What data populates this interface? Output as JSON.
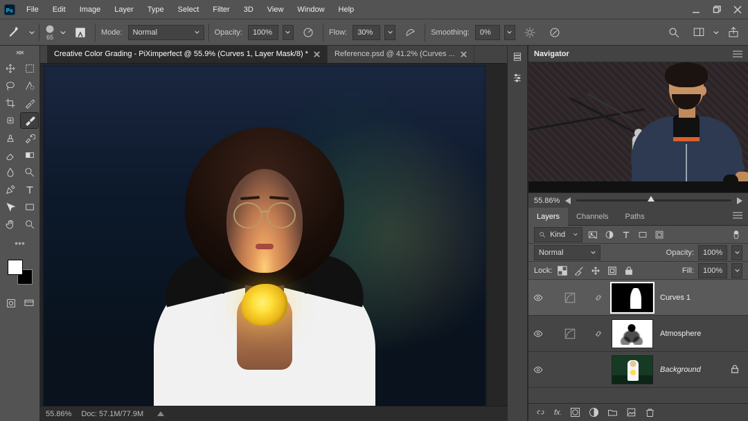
{
  "menu": {
    "items": [
      "File",
      "Edit",
      "Image",
      "Layer",
      "Type",
      "Select",
      "Filter",
      "3D",
      "View",
      "Window",
      "Help"
    ]
  },
  "options": {
    "brush_size": "65",
    "mode_label": "Mode:",
    "mode_value": "Normal",
    "opacity_label": "Opacity:",
    "opacity_value": "100%",
    "flow_label": "Flow:",
    "flow_value": "30%",
    "smoothing_label": "Smoothing:",
    "smoothing_value": "0%"
  },
  "tabs": {
    "active": "Creative Color Grading - PiXimperfect @ 55.9% (Curves 1, Layer Mask/8) *",
    "inactive": "Reference.psd @ 41.2% (Curves ..."
  },
  "status": {
    "zoom": "55.86%",
    "doc": "Doc: 57.1M/77.9M"
  },
  "navigator": {
    "title": "Navigator",
    "zoom": "55.86%"
  },
  "layers_panel": {
    "tabs": [
      "Layers",
      "Channels",
      "Paths"
    ],
    "filter_kind": "Kind",
    "blend_mode": "Normal",
    "opacity_label": "Opacity:",
    "opacity_value": "100%",
    "lock_label": "Lock:",
    "fill_label": "Fill:",
    "fill_value": "100%",
    "layers": [
      {
        "name": "Curves 1",
        "selected": true,
        "visible": true,
        "locked": false,
        "kind": "adjustment-mask"
      },
      {
        "name": "Atmosphere",
        "selected": false,
        "visible": true,
        "locked": false,
        "kind": "adjustment-mask"
      },
      {
        "name": "Background",
        "selected": false,
        "visible": true,
        "locked": true,
        "kind": "image"
      }
    ]
  },
  "colors": {
    "fg": "#ffffff",
    "bg": "#000000"
  }
}
